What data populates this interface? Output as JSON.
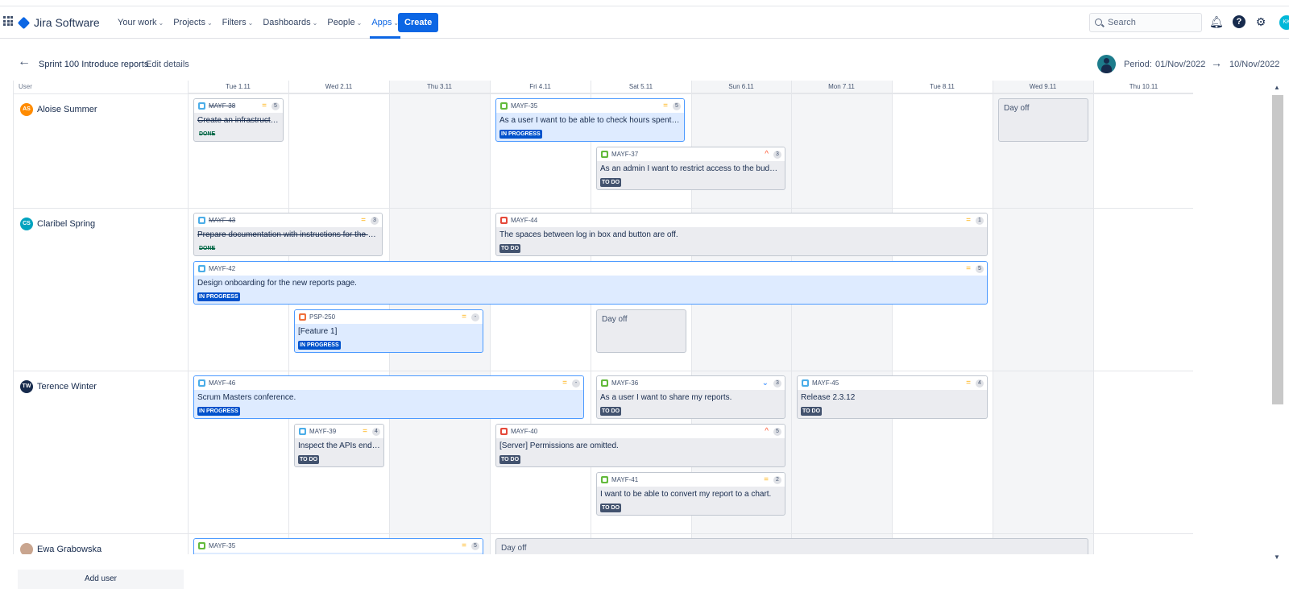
{
  "nav": {
    "app": "Jira Software",
    "items": [
      {
        "label": "Your work"
      },
      {
        "label": "Projects"
      },
      {
        "label": "Filters"
      },
      {
        "label": "Dashboards"
      },
      {
        "label": "People"
      },
      {
        "label": "Apps"
      }
    ],
    "create": "Create",
    "search_placeholder": "Search",
    "avatar": "KK"
  },
  "header": {
    "sprint": "Sprint 100 Introduce reports",
    "edit": "Edit details",
    "period_label": "Period:",
    "start": "01/Nov/2022",
    "end": "10/Nov/2022"
  },
  "board": {
    "user_header": "User",
    "days": [
      "Tue 1.11",
      "Wed 2.11",
      "Thu 3.11",
      "Fri 4.11",
      "Sat 5.11",
      "Sun 6.11",
      "Mon 7.11",
      "Tue 8.11",
      "Wed 9.11",
      "Thu 10.11"
    ],
    "users": [
      {
        "initials": "AS",
        "name": "Aloise Summer",
        "color": "#ff8b00"
      },
      {
        "initials": "CS",
        "name": "Claribel Spring",
        "color": "#00a3bf"
      },
      {
        "initials": "TW",
        "name": "Terence Winter",
        "color": "#172b4d"
      },
      {
        "initials": "",
        "name": "Ewa Grabowska",
        "color": "#c9a58f"
      }
    ],
    "cards": [
      {
        "key": "MAYF-38",
        "pts": "5",
        "summary": "Create an infrastructu...",
        "status": "DONE"
      },
      {
        "key": "MAYF-35",
        "pts": "5",
        "summary": "As a user I want to be able to check hours spent o...",
        "status": "IN PROGRESS"
      },
      {
        "key": "MAYF-37",
        "pts": "3",
        "summary": "As an admin I want to restrict access to the budget...",
        "status": "TO DO"
      },
      {
        "key": "MAYF-43",
        "pts": "3",
        "summary": "Prepare documentation with instructions for the e...",
        "status": "DONE"
      },
      {
        "key": "MAYF-44",
        "pts": "1",
        "summary": "The spaces between log in box and button are off.",
        "status": "TO DO"
      },
      {
        "key": "MAYF-42",
        "pts": "5",
        "summary": "Design onboarding for the new reports page.",
        "status": "IN PROGRESS"
      },
      {
        "key": "PSP-250",
        "pts": "-",
        "summary": "[Feature 1]",
        "status": "IN PROGRESS"
      },
      {
        "key": "MAYF-46",
        "pts": "-",
        "summary": "Scrum Masters conference.",
        "status": "IN PROGRESS"
      },
      {
        "key": "MAYF-36",
        "pts": "3",
        "summary": "As a user I want to share my reports.",
        "status": "TO DO"
      },
      {
        "key": "MAYF-45",
        "pts": "4",
        "summary": "Release 2.3.12",
        "status": "TO DO"
      },
      {
        "key": "MAYF-39",
        "pts": "4",
        "summary": "Inspect the APIs endp...",
        "status": "TO DO"
      },
      {
        "key": "MAYF-40",
        "pts": "5",
        "summary": "[Server] Permissions are omitted.",
        "status": "TO DO"
      },
      {
        "key": "MAYF-41",
        "pts": "2",
        "summary": "I want to be able to convert my report to a chart.",
        "status": "TO DO"
      },
      {
        "key": "MAYF-35",
        "pts": "5"
      }
    ],
    "dayoff": "Day off",
    "add_user": "Add user"
  }
}
